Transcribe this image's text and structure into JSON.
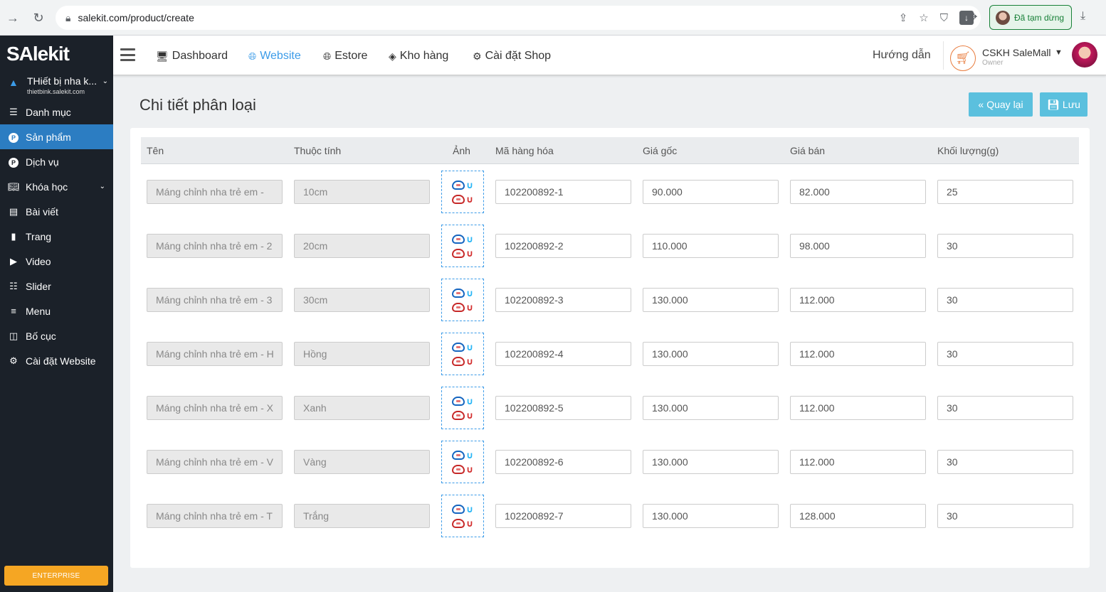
{
  "browser": {
    "url": "salekit.com/product/create",
    "paused_label": "Đã tạm dừng"
  },
  "sidebar": {
    "logo": "SAlekit",
    "shop_name": "THiết bị nha k...",
    "shop_domain": "thietbink.salekit.com",
    "items": [
      {
        "label": "Danh mục",
        "icon": "list-icon"
      },
      {
        "label": "Sản phẩm",
        "icon": "product-p-icon",
        "active": true
      },
      {
        "label": "Dịch vụ",
        "icon": "service-p-icon"
      },
      {
        "label": "Khóa học",
        "icon": "book-icon",
        "has_children": true
      },
      {
        "label": "Bài viết",
        "icon": "newspaper-icon"
      },
      {
        "label": "Trang",
        "icon": "file-icon"
      },
      {
        "label": "Video",
        "icon": "video-icon"
      },
      {
        "label": "Slider",
        "icon": "sliders-icon"
      },
      {
        "label": "Menu",
        "icon": "bars-icon"
      },
      {
        "label": "Bố cục",
        "icon": "columns-icon"
      },
      {
        "label": "Cài đặt Website",
        "icon": "gear-icon"
      }
    ],
    "badge": "ENTERPRISE"
  },
  "topnav": {
    "items": [
      {
        "label": "Dashboard",
        "icon": "desktop-icon"
      },
      {
        "label": "Website",
        "icon": "globe-icon",
        "active": true
      },
      {
        "label": "Estore",
        "icon": "globe-icon"
      },
      {
        "label": "Kho hàng",
        "icon": "layers-icon"
      },
      {
        "label": "Cài đặt Shop",
        "icon": "gear-icon"
      }
    ],
    "help": "Hướng dẫn",
    "user_name": "CSKH SaleMall",
    "user_role": "Owner"
  },
  "page": {
    "title": "Chi tiết phân loại",
    "back_label": "Quay lại",
    "save_label": "Lưu"
  },
  "table": {
    "headers": [
      "Tên",
      "Thuộc tính",
      "Ảnh",
      "Mã hàng hóa",
      "Giá gốc",
      "Giá bán",
      "Khối lượng(g)"
    ],
    "rows": [
      {
        "name": "Máng chỉnh nha trẻ em - ",
        "attr": "10cm",
        "sku": "102200892-1",
        "price": "90.000",
        "sale": "82.000",
        "weight": "25"
      },
      {
        "name": "Máng chỉnh nha trẻ em - 2",
        "attr": "20cm",
        "sku": "102200892-2",
        "price": "110.000",
        "sale": "98.000",
        "weight": "30"
      },
      {
        "name": "Máng chỉnh nha trẻ em - 3",
        "attr": "30cm",
        "sku": "102200892-3",
        "price": "130.000",
        "sale": "112.000",
        "weight": "30"
      },
      {
        "name": "Máng chỉnh nha trẻ em - H",
        "attr": "Hồng",
        "sku": "102200892-4",
        "price": "130.000",
        "sale": "112.000",
        "weight": "30"
      },
      {
        "name": "Máng chỉnh nha trẻ em - X",
        "attr": "Xanh",
        "sku": "102200892-5",
        "price": "130.000",
        "sale": "112.000",
        "weight": "30"
      },
      {
        "name": "Máng chỉnh nha trẻ em - V",
        "attr": "Vàng",
        "sku": "102200892-6",
        "price": "130.000",
        "sale": "112.000",
        "weight": "30"
      },
      {
        "name": "Máng chỉnh nha trẻ em - T",
        "attr": "Trắng",
        "sku": "102200892-7",
        "price": "130.000",
        "sale": "128.000",
        "weight": "30"
      }
    ]
  },
  "colors": {
    "sidebar_bg": "#1b2129",
    "active_blue": "#2c7dc2",
    "link_blue": "#3b9be8",
    "button": "#5bc0de",
    "enterprise": "#f5a623"
  }
}
